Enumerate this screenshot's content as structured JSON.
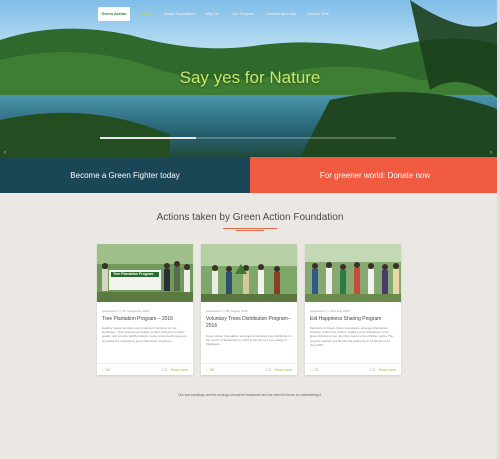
{
  "nav": {
    "logo_text": "Green Action",
    "items": [
      {
        "label": "Home",
        "active": true
      },
      {
        "label": "About Foundation",
        "active": false
      },
      {
        "label": "Why Us",
        "active": false
      },
      {
        "label": "Our Projects",
        "active": false
      },
      {
        "label": "Contact and help",
        "active": false
      },
      {
        "label": "Donate Tree",
        "active": false
      }
    ]
  },
  "hero": {
    "title": "Say yes for Nature",
    "prev_arrow": "‹",
    "next_arrow": "›"
  },
  "cta": {
    "left": "Become a Green Fighter today",
    "right": "For greener world: Donate now"
  },
  "section": {
    "title": "Actions taken by Green Action Foundation"
  },
  "cards": [
    {
      "meta": "greenaction  ◷  7th September 2016",
      "title": "Tree Plantation Program – 2016",
      "excerpt": "Healthy forests provide many important functions on our landscape. They improve air quality, surface and ground water quality, and provide wildlife habitat. Large connected forests are important for maintaining good watershed conditions.",
      "likes": "♡ 60",
      "comments": "☐ 0",
      "read_more": "Read more",
      "banner": "Tree Plantation Program"
    },
    {
      "meta": "greenaction  ◷  8th August 2016",
      "title": "Voluntary Trees Distribution Program–2016",
      "excerpt": "Green action Foundation arranged a voluntary tree distribution in the month of September in 2016 to the farmers of a village in Manikganj.",
      "likes": "♡ 65",
      "comments": "☐ 0",
      "read_more": "Read more",
      "banner": ""
    },
    {
      "meta": "greenaction  ◷  23rd July 2016",
      "title": "Eid Happiness Sharing Program",
      "excerpt": "Members of Green Action Foundation arranged distribution program of Eid new clothes. Clothes were distributed to the green distress of our city that means to the children pathe. The program started at 9:00 AM and lasting up to 11:00 AM of 21 July 2016.",
      "likes": "♡ 70",
      "comments": "☐ 0",
      "read_more": "Read more",
      "banner": ""
    }
  ],
  "tagline": "Our surroundings and its ecology should be balanced and we need to focus on maintaining it.",
  "colors": {
    "cta_left": "#1a4656",
    "cta_right": "#f05a41",
    "accent_green": "#8bbf2f",
    "hero_title": "#c7ea6a"
  }
}
